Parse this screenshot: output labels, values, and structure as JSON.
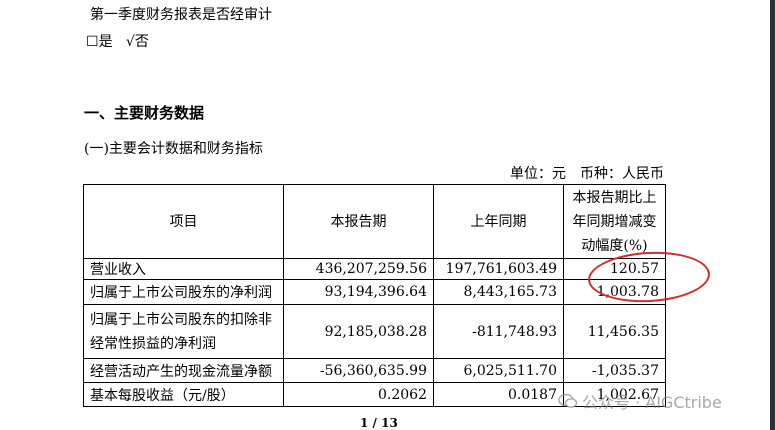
{
  "audit_question": "第一季度财务报表是否经审计",
  "audit_answer": {
    "yes_box": "☐",
    "yes_label": "是",
    "no_mark": "√",
    "no_label": "否"
  },
  "section_title": "一、主要财务数据",
  "subsection_title": "(一)主要会计数据和财务指标",
  "unit_line": {
    "unit": "单位：元",
    "currency": "币种：人民币"
  },
  "table": {
    "headers": {
      "item": "项目",
      "current": "本报告期",
      "prior": "上年同期",
      "change_line1": "本报告期比上",
      "change_line2": "年同期增减变",
      "change_line3": "动幅度(%)"
    },
    "rows": [
      {
        "label": "营业收入",
        "current": "436,207,259.56",
        "prior": "197,761,603.49",
        "change": "120.57"
      },
      {
        "label": "归属于上市公司股东的净利润",
        "current": "93,194,396.64",
        "prior": "8,443,165.73",
        "change": "1,003.78"
      },
      {
        "label_line1": "归属于上市公司股东的扣除非",
        "label_line2": "经常性损益的净利润",
        "current": "92,185,038.28",
        "prior": "-811,748.93",
        "change": "11,456.35"
      },
      {
        "label": "经营活动产生的现金流量净额",
        "current": "-56,360,635.99",
        "prior": "6,025,511.70",
        "change": "-1,035.37"
      },
      {
        "label": "基本每股收益（元/股）",
        "current": "0.2062",
        "prior": "0.0187",
        "change": "1,002.67"
      }
    ]
  },
  "annotation_color": "#d42a2a",
  "page_number": "1 / 13",
  "watermark": "公众号 · AIGCtribe"
}
